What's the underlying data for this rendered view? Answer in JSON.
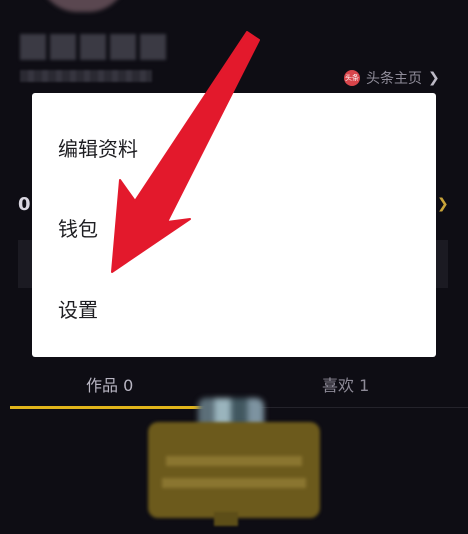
{
  "profile": {
    "toutiao_badge": "头条",
    "toutiao_label": "头条主页",
    "stat_zero": "0"
  },
  "menu": {
    "items": [
      {
        "label": "编辑资料"
      },
      {
        "label": "钱包"
      },
      {
        "label": "设置"
      }
    ]
  },
  "tabs": {
    "items": [
      {
        "label": "作品 0"
      },
      {
        "label": "喜欢 1"
      }
    ]
  },
  "colors": {
    "background": "#0e0d14",
    "menu_bg": "#ffffff",
    "tab_underline": "#e2b51b",
    "arrow": "#e3192c",
    "toutiao_red": "#d8454b"
  }
}
